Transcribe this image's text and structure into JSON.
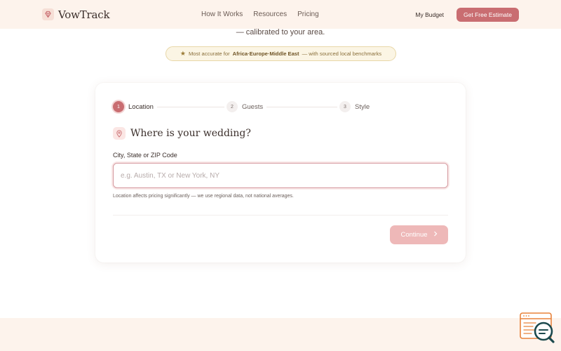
{
  "header": {
    "brand_name": "VowTrack",
    "nav_links": [
      "How It Works",
      "Resources",
      "Pricing"
    ],
    "my_budget_label": "My Budget",
    "cta_label": "Get Free Estimate"
  },
  "hero": {
    "subhead": "— calibrated to your area.",
    "accuracy_prefix": "Most accurate for",
    "accuracy_regions": "Africa·Europe·Middle East",
    "accuracy_suffix": "— with sourced local benchmarks"
  },
  "stepper": {
    "steps": [
      {
        "number": "1",
        "label": "Location"
      },
      {
        "number": "2",
        "label": "Guests"
      },
      {
        "number": "3",
        "label": "Style"
      }
    ]
  },
  "form": {
    "question": "Where is your wedding?",
    "field_label": "City, State or ZIP Code",
    "input_placeholder": "e.g. Austin, TX or New York, NY",
    "input_value": "",
    "hint": "Location affects pricing significantly — we use regional data, not national averages.",
    "continue_label": "Continue"
  },
  "colors": {
    "accent": "#c96d71",
    "accent_disabled": "#eeb8b8",
    "header_bg": "#fdf3ec",
    "pill_bg": "#fbf5e4"
  },
  "icons": {
    "brand": "diamond-icon",
    "accuracy": "star-icon",
    "question": "map-pin-icon",
    "continue": "chevron-right-icon",
    "widget": "chat-search-icon"
  }
}
